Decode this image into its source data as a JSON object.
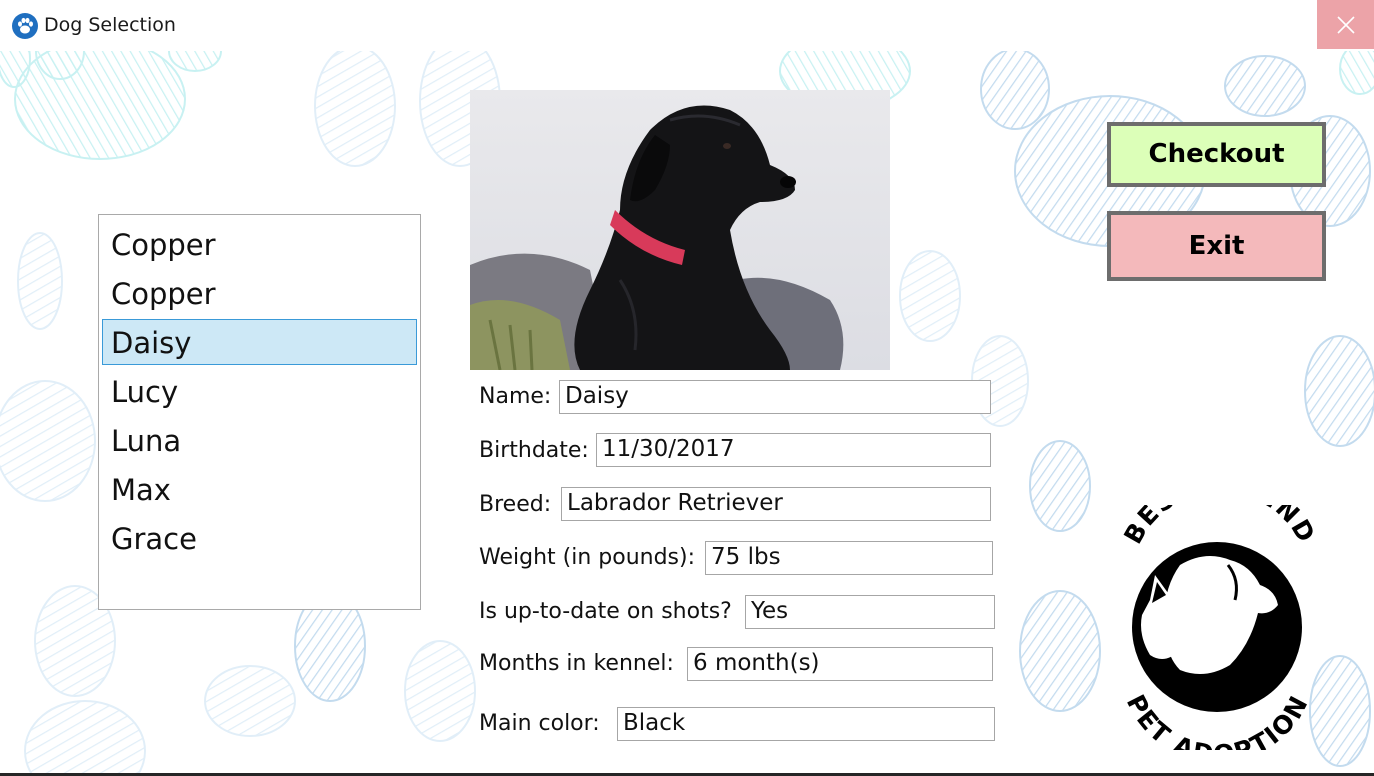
{
  "window": {
    "title": "Dog Selection",
    "close_icon": "close-icon"
  },
  "dog_list": {
    "items": [
      "Copper",
      "Copper",
      "Daisy",
      "Lucy",
      "Luna",
      "Max",
      "Grace"
    ],
    "selected": "Daisy"
  },
  "details": {
    "name_label": "Name:",
    "name_value": "Daisy",
    "birthdate_label": "Birthdate:",
    "birthdate_value": "11/30/2017",
    "breed_label": "Breed:",
    "breed_value": "Labrador Retriever",
    "weight_label": "Weight (in pounds):",
    "weight_value": "75 lbs",
    "shots_label": "Is up-to-date on shots?",
    "shots_value": "Yes",
    "kennel_label": "Months in kennel:",
    "kennel_value": "6 month(s)",
    "color_label": "Main color:",
    "color_value": "Black"
  },
  "buttons": {
    "checkout": "Checkout",
    "exit": "Exit"
  },
  "logo": {
    "top_text": "BEST FRIEND",
    "bottom_text": "PET ADOPTION"
  },
  "colors": {
    "checkout_bg": "#dcffb8",
    "exit_bg": "#f4b9bb",
    "close_bg": "#eca3a8",
    "selection_bg": "#cde8f6",
    "selection_border": "#3a9ad8",
    "paw_blue": "#b9d5ec",
    "paw_teal": "#bfeff0"
  }
}
